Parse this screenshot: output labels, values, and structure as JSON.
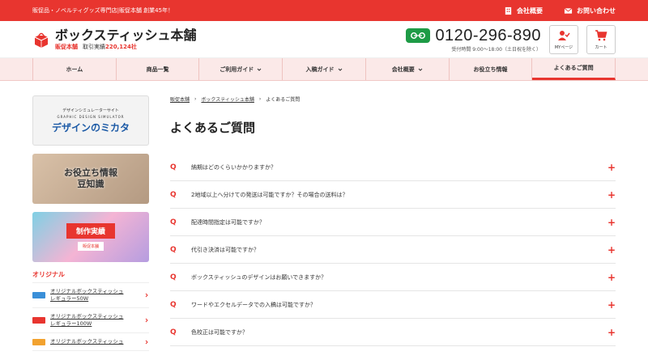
{
  "topbar": {
    "tagline": "販促品・ノベルティグッズ専門店|販促本舗 創業45年！",
    "company": "会社概要",
    "contact": "お問い合わせ"
  },
  "header": {
    "brand_name": "ボックスティッシュ本舗",
    "brand_sub_tag": "販促本舗",
    "brand_sub_label": "取引実績",
    "brand_sub_count": "220,124社",
    "tel": "0120-296-890",
    "hours": "受付時間 9:00～18:00（土日祝を除く）",
    "mypage": "MYページ",
    "cart": "カート"
  },
  "nav": [
    {
      "label": "ホーム",
      "dropdown": false
    },
    {
      "label": "商品一覧",
      "dropdown": false
    },
    {
      "label": "ご利用ガイド",
      "dropdown": true
    },
    {
      "label": "入稿ガイド",
      "dropdown": true
    },
    {
      "label": "会社概要",
      "dropdown": true
    },
    {
      "label": "お役立ち情報",
      "dropdown": false
    },
    {
      "label": "よくあるご質問",
      "dropdown": false
    }
  ],
  "sidebar": {
    "banner1": {
      "small": "デザインシミュレーターサイト",
      "en": "GRAPHIC DESIGN SIMULATOR",
      "big": "デザインのミカタ"
    },
    "banner2": {
      "line1": "お役立ち情報",
      "line2": "豆知識"
    },
    "banner3": {
      "title": "制作実績",
      "sub": "販促本舗"
    },
    "section_title": "オリジナル",
    "products": [
      {
        "line1": "オリジナルボックスティッシュ",
        "line2": "レギュラー50W",
        "color": "#3a8fd8"
      },
      {
        "line1": "オリジナルボックスティッシュ",
        "line2": "レギュラー100W",
        "color": "#e8352f"
      },
      {
        "line1": "オリジナルボックスティッシュ",
        "line2": "",
        "color": "#f2a22f"
      }
    ]
  },
  "breadcrumb": [
    "販促本舗",
    "ボックスティッシュ本舗",
    "よくあるご質問"
  ],
  "page_title": "よくあるご質問",
  "faq_marker": "Q",
  "faq_plus": "+",
  "faqs": [
    "納期はどのくらいかかりますか？",
    "2地域以上へ分けての発送は可能ですか？その場合の送料は？",
    "配達時間指定は可能ですか？",
    "代引き決済は可能ですか？",
    "ボックスティッシュのデザインはお願いできますか？",
    "ワードやエクセルデータでの入稿は可能ですか？",
    "色校正は可能ですか？"
  ],
  "colors": {
    "accent": "#e8352f",
    "free_dial": "#1e9b46",
    "nav_bg": "#fbe9e8"
  }
}
